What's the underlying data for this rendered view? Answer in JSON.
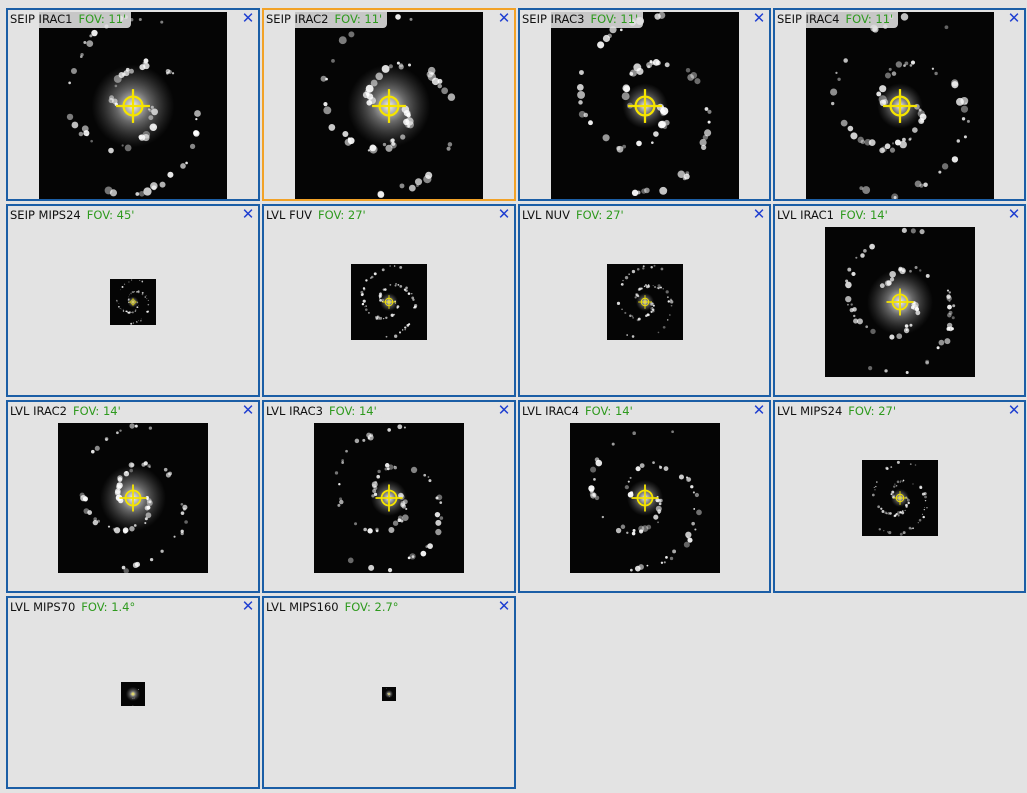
{
  "tiles": [
    {
      "name": "SEIP IRAC1",
      "fov": "FOV: 11'",
      "selected": false,
      "intensity": "bright-core"
    },
    {
      "name": "SEIP IRAC2",
      "fov": "FOV: 11'",
      "selected": true,
      "intensity": "bright-core"
    },
    {
      "name": "SEIP IRAC3",
      "fov": "FOV: 11'",
      "selected": false,
      "intensity": "arms"
    },
    {
      "name": "SEIP IRAC4",
      "fov": "FOV: 11'",
      "selected": false,
      "intensity": "arms"
    },
    {
      "name": "SEIP MIPS24",
      "fov": "FOV: 45'",
      "selected": false,
      "intensity": "arms"
    },
    {
      "name": "LVL FUV",
      "fov": "FOV: 27'",
      "selected": false,
      "intensity": "arms"
    },
    {
      "name": "LVL NUV",
      "fov": "FOV: 27'",
      "selected": false,
      "intensity": "arms"
    },
    {
      "name": "LVL IRAC1",
      "fov": "FOV: 14'",
      "selected": false,
      "intensity": "bright-core"
    },
    {
      "name": "LVL IRAC2",
      "fov": "FOV: 14'",
      "selected": false,
      "intensity": "bright-core"
    },
    {
      "name": "LVL IRAC3",
      "fov": "FOV: 14'",
      "selected": false,
      "intensity": "arms"
    },
    {
      "name": "LVL IRAC4",
      "fov": "FOV: 14'",
      "selected": false,
      "intensity": "arms"
    },
    {
      "name": "LVL MIPS24",
      "fov": "FOV: 27'",
      "selected": false,
      "intensity": "arms"
    },
    {
      "name": "LVL MIPS70",
      "fov": "FOV: 1.4°",
      "selected": false,
      "intensity": "blob"
    },
    {
      "name": "LVL MIPS160",
      "fov": "FOV: 2.7°",
      "selected": false,
      "intensity": "blob"
    }
  ],
  "close_glyph": "✕",
  "colors": {
    "panel_border": "#1b5ea6",
    "selected_border": "#f2a227",
    "fov_text": "#2e9a1e",
    "close_icon": "#1f3fd1",
    "crosshair": "#f5e400"
  }
}
